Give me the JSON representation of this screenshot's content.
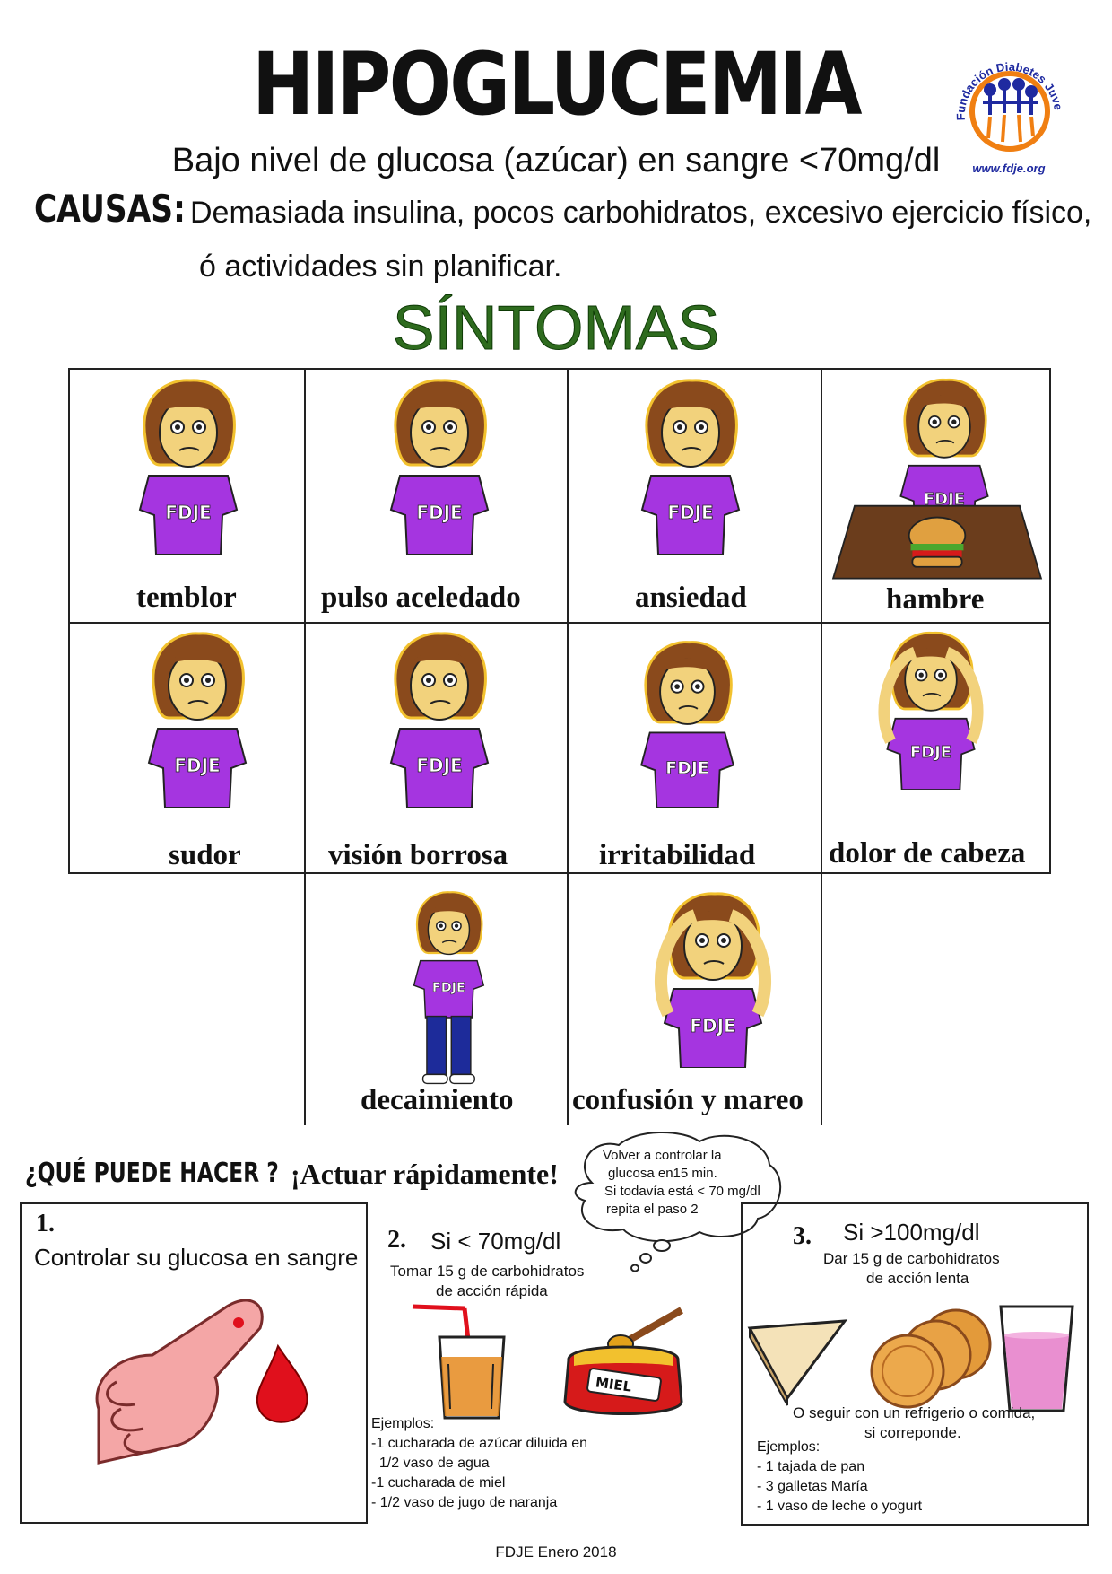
{
  "header": {
    "title": "HIPOGLUCEMIA",
    "subtitle": "Bajo nivel de glucosa (azúcar) en sangre <70mg/dl",
    "causas_label": "CAUSAS:",
    "causas_line1": "Demasiada insulina, pocos carbohidratos, excesivo ejercicio físico,",
    "causas_line2": "ó actividades sin planificar.",
    "logo_text": "Fundación Diabetes Juvenil Ecuador",
    "logo_url": "www.fdje.org"
  },
  "sintomas": {
    "heading": "SÍNTOMAS",
    "shirt_text": "FDJE",
    "items": [
      "temblor",
      "pulso aceledado",
      "ansiedad",
      "hambre",
      "sudor",
      "visión borrosa",
      "irritabilidad",
      "dolor de cabeza",
      "decaimiento",
      "confusión y mareo"
    ]
  },
  "actions": {
    "question": "¿QUÉ PUEDE HACER ?",
    "urge": "¡Actuar rápidamente!",
    "bubble": [
      "Volver a controlar la",
      "glucosa en15 min.",
      "Si todavía está < 70 mg/dl",
      "repita el paso 2"
    ],
    "step1": {
      "num": "1.",
      "title": "Controlar su glucosa en sangre"
    },
    "step2": {
      "num": "2.",
      "title": "Si < 70mg/dl",
      "desc1": "Tomar 15 g de carbohidratos",
      "desc2": "de acción rápida",
      "honey_label": "MIEL",
      "examples": [
        "Ejemplos:",
        "-1 cucharada de azúcar diluida en",
        "  1/2 vaso de agua",
        "-1 cucharada de miel",
        "- 1/2 vaso de jugo de naranja"
      ]
    },
    "step3": {
      "num": "3.",
      "title": "Si >100mg/dl",
      "desc1": "Dar 15 g de carbohidratos",
      "desc2": "de acción lenta",
      "note1": "O seguir con un refrigerio  o comida,",
      "note2": "si correponde.",
      "examples": [
        "Ejemplos:",
        "- 1 tajada de pan",
        "- 3 galletas María",
        "- 1 vaso de leche o yogurt"
      ]
    }
  },
  "footer": "FDJE Enero 2018",
  "colors": {
    "shirt": "#a535e0",
    "hair": "#8a4a1c",
    "skin": "#f2d27c",
    "sintomas": "#2e6b1e",
    "blood": "#e0101c",
    "logo_ring": "#f07f12"
  }
}
